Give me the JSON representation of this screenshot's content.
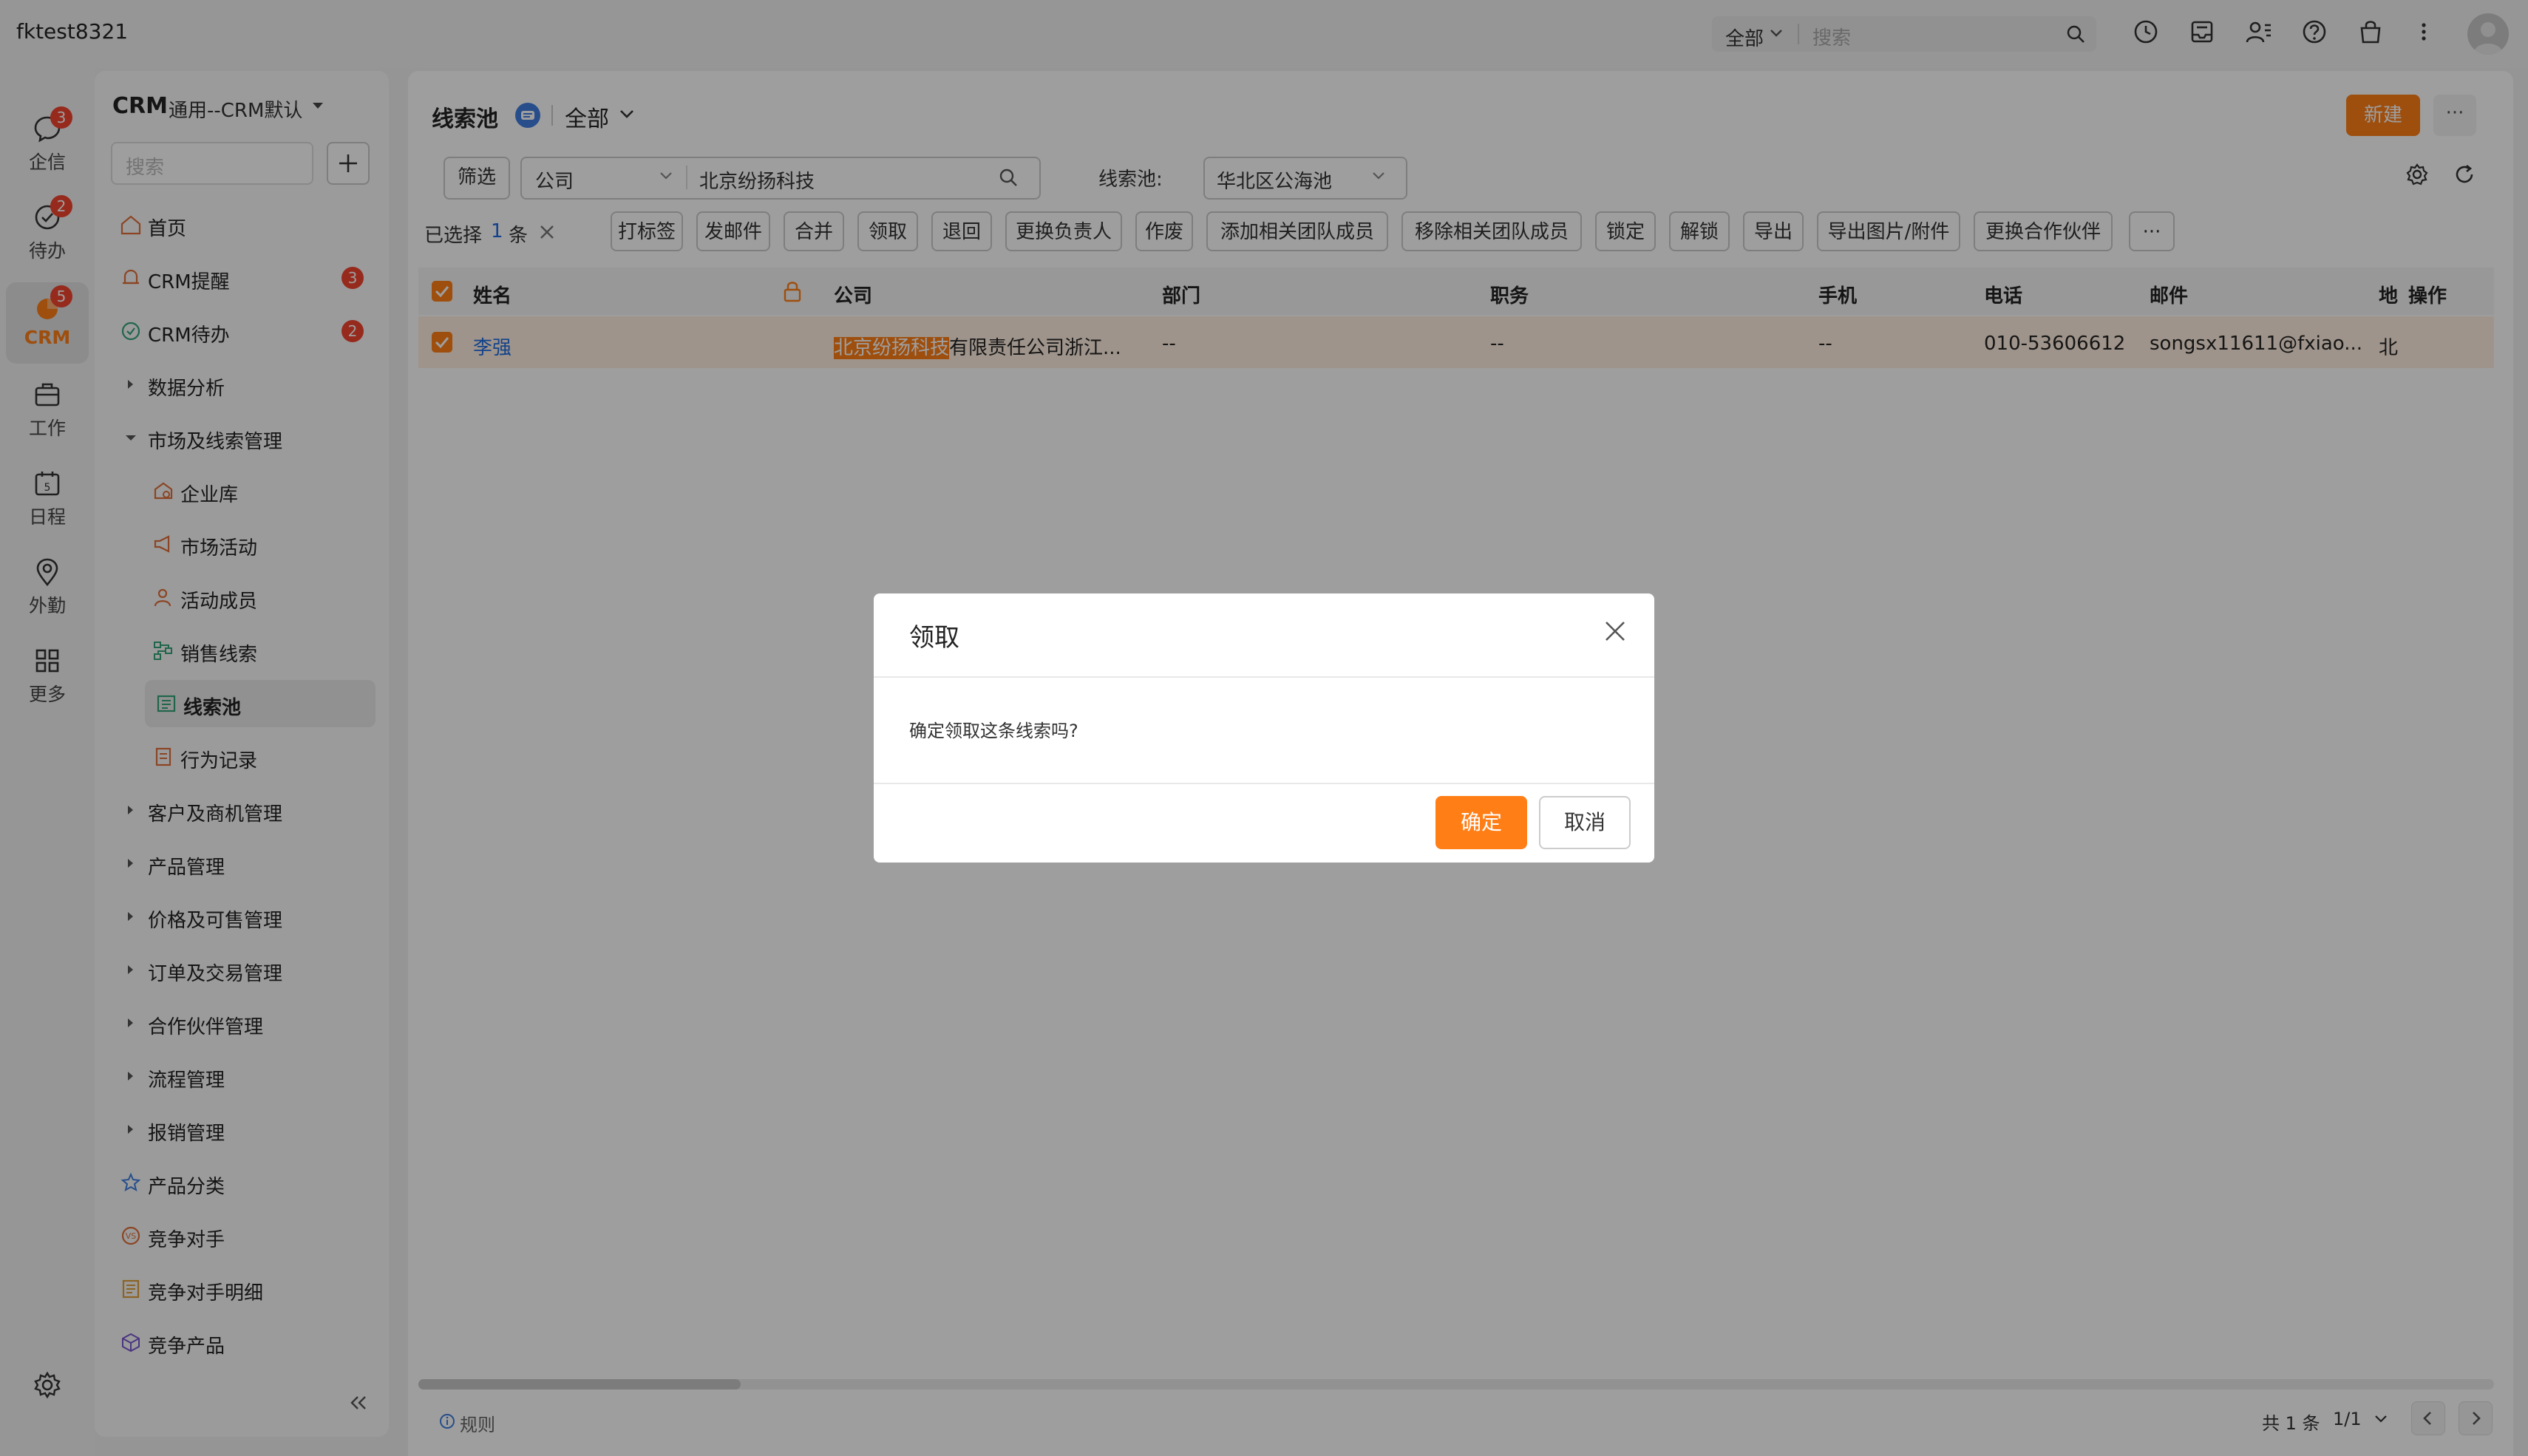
{
  "header": {
    "username": "fktest8321",
    "search_scope": "全部",
    "search_placeholder": "搜索"
  },
  "rail": {
    "items": [
      {
        "label": "企信",
        "badge": "3",
        "icon": "chat-bubble-icon"
      },
      {
        "label": "待办",
        "badge": "2",
        "icon": "check-circle-icon"
      },
      {
        "label": "CRM",
        "badge": "5",
        "icon": "crm-pie-icon"
      },
      {
        "label": "工作",
        "icon": "briefcase-icon"
      },
      {
        "label": "日程",
        "icon": "calendar-icon"
      },
      {
        "label": "外勤",
        "icon": "location-pin-icon"
      },
      {
        "label": "更多",
        "icon": "grid-icon"
      }
    ]
  },
  "sidenav": {
    "app_name": "CRM",
    "app_variant": "通用--CRM默认",
    "search_placeholder": "搜索",
    "items": [
      {
        "label": "首页",
        "icon": "home-icon"
      },
      {
        "label": "CRM提醒",
        "icon": "bell-icon",
        "badge": "3"
      },
      {
        "label": "CRM待办",
        "icon": "check-circle-icon",
        "badge": "2"
      },
      {
        "label": "数据分析",
        "icon": "caret-right-icon"
      },
      {
        "label": "市场及线索管理",
        "icon": "caret-down-icon"
      },
      {
        "label": "企业库",
        "icon": "company-icon"
      },
      {
        "label": "市场活动",
        "icon": "megaphone-icon"
      },
      {
        "label": "活动成员",
        "icon": "person-icon"
      },
      {
        "label": "销售线索",
        "icon": "flow-icon"
      },
      {
        "label": "线索池",
        "icon": "pool-icon"
      },
      {
        "label": "行为记录",
        "icon": "record-icon"
      },
      {
        "label": "客户及商机管理",
        "icon": "caret-right-icon"
      },
      {
        "label": "产品管理",
        "icon": "caret-right-icon"
      },
      {
        "label": "价格及可售管理",
        "icon": "caret-right-icon"
      },
      {
        "label": "订单及交易管理",
        "icon": "caret-right-icon"
      },
      {
        "label": "合作伙伴管理",
        "icon": "caret-right-icon"
      },
      {
        "label": "流程管理",
        "icon": "caret-right-icon"
      },
      {
        "label": "报销管理",
        "icon": "caret-right-icon"
      },
      {
        "label": "产品分类",
        "icon": "category-icon"
      },
      {
        "label": "竞争对手",
        "icon": "vs-icon"
      },
      {
        "label": "竞争对手明细",
        "icon": "detail-list-icon"
      },
      {
        "label": "竞争产品",
        "icon": "cube-icon"
      }
    ]
  },
  "main": {
    "page_title": "线索池",
    "view_name": "全部",
    "new_button": "新建",
    "more_button": "···",
    "filter_button": "筛选",
    "filter_field": "公司",
    "filter_value": "北京纷扬科技",
    "pool_label": "线索池:",
    "pool_value": "华北区公海池",
    "selection": {
      "prefix": "已选择",
      "count": "1",
      "unit": "条"
    },
    "actions": [
      "打标签",
      "发邮件",
      "合并",
      "领取",
      "退回",
      "更换负责人",
      "作废",
      "添加相关团队成员",
      "移除相关团队成员",
      "锁定",
      "解锁",
      "导出",
      "导出图片/附件",
      "更换合作伙伴",
      "···"
    ],
    "table": {
      "columns": [
        "姓名",
        "公司",
        "部门",
        "职务",
        "手机",
        "电话",
        "邮件",
        "地",
        "操作"
      ],
      "rows": [
        {
          "name": "李强",
          "company_highlight": "北京纷扬科技",
          "company_rest": "有限责任公司浙江...",
          "department": "--",
          "title": "--",
          "mobile": "--",
          "phone": "010-53606612",
          "email": "songsx11611@fxiao...",
          "region": "北"
        }
      ]
    },
    "footer": {
      "rules": "规则",
      "total": "共 1 条",
      "page": "1/1"
    }
  },
  "modal": {
    "title": "领取",
    "message": "确定领取这条线索吗?",
    "confirm": "确定",
    "cancel": "取消"
  },
  "colors": {
    "accent": "#ff7e16",
    "link": "#1e6be0",
    "badge": "#f2452f"
  }
}
